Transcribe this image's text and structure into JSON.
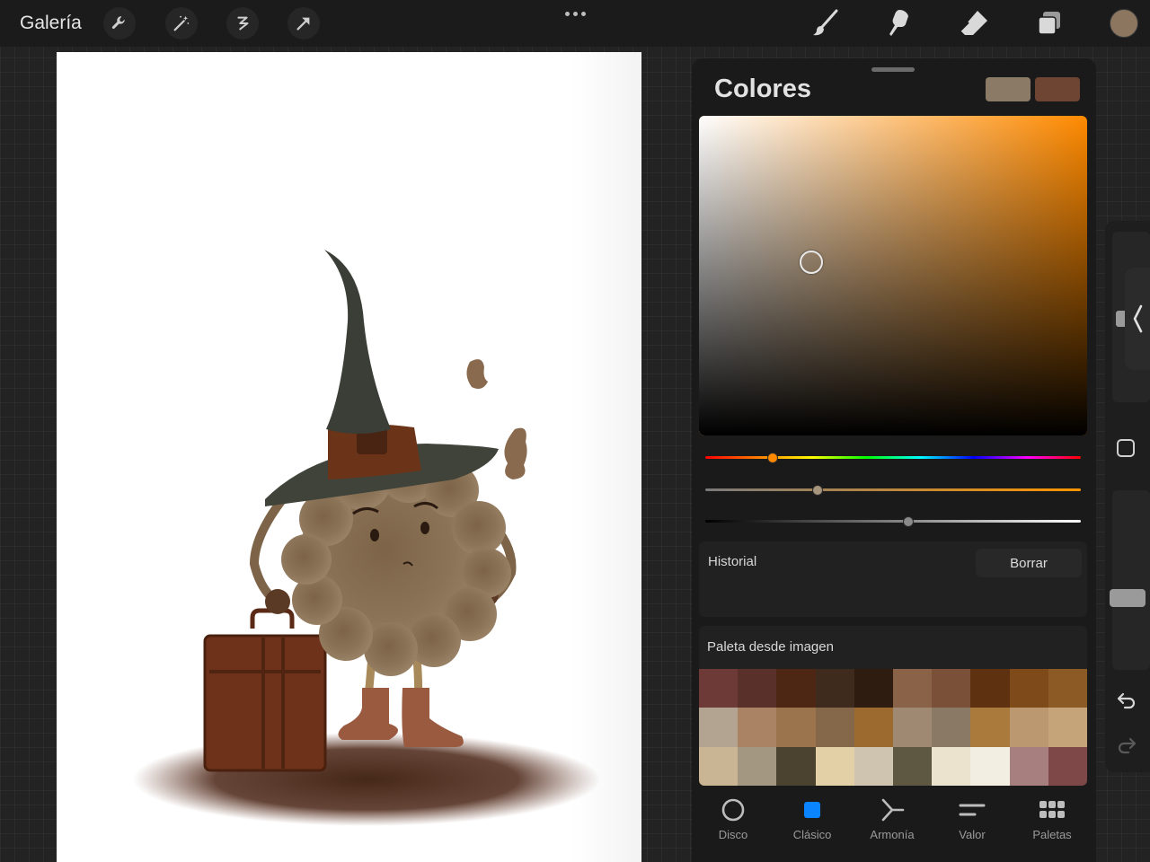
{
  "toolbar": {
    "gallery_label": "Galería",
    "left_tools": [
      "wrench-icon",
      "magic-wand-icon",
      "selection-icon",
      "transform-arrow-icon"
    ],
    "more_icon": "ellipsis-icon",
    "right_tools": [
      "brush-icon",
      "smudge-icon",
      "eraser-icon",
      "layers-icon"
    ],
    "current_color": "#8c7660"
  },
  "panel": {
    "title": "Colores",
    "primary_swatch": "#8a7a66",
    "secondary_swatch": "#6d4532",
    "hue_color": "#ff8a00",
    "sliders": {
      "hue": 0.18,
      "saturation": 0.3,
      "brightness": 0.54
    },
    "history": {
      "label": "Historial",
      "clear_label": "Borrar"
    },
    "palette": {
      "label": "Paleta desde imagen",
      "colors": [
        "#6e3a38",
        "#5a302b",
        "#4e2714",
        "#3f2a1e",
        "#2e1c10",
        "#8a6248",
        "#7a5038",
        "#5e3210",
        "#7e4a1a",
        "#8c5a24",
        "#b3a391",
        "#a98364",
        "#9b734c",
        "#85684a",
        "#9c6a2e",
        "#a08972",
        "#8a7a65",
        "#a97a3c",
        "#bb9870",
        "#c5a47a",
        "#c9b593",
        "#a39781",
        "#4c4230",
        "#e3d0a6",
        "#cfc4b0",
        "#5e5843",
        "#ece3cf",
        "#f3eee2",
        "#a87f7f",
        "#7f4848"
      ]
    },
    "tabs": [
      {
        "id": "disco",
        "label": "Disco",
        "icon": "disc-icon",
        "active": false
      },
      {
        "id": "clasico",
        "label": "Clásico",
        "icon": "classic-square-icon",
        "active": true
      },
      {
        "id": "armonia",
        "label": "Armonía",
        "icon": "harmony-icon",
        "active": false
      },
      {
        "id": "valor",
        "label": "Valor",
        "icon": "value-sliders-icon",
        "active": false
      },
      {
        "id": "paletas",
        "label": "Paletas",
        "icon": "palettes-grid-icon",
        "active": false
      }
    ],
    "accent": "#0a84ff"
  },
  "sidebar": {
    "icons": [
      "collapse-chevron-icon",
      "modify-square-icon",
      "undo-icon",
      "redo-icon"
    ]
  }
}
